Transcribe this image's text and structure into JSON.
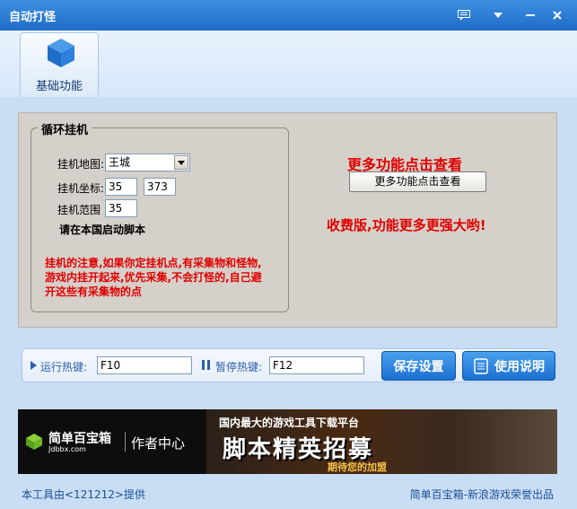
{
  "window": {
    "title": "自动打怪",
    "controls": [
      "message-icon",
      "dropdown-icon",
      "minimize-icon",
      "close-icon"
    ]
  },
  "tabs": [
    {
      "label": "基础功能",
      "icon": "cube-icon"
    }
  ],
  "loop_group": {
    "title": "循环挂机",
    "map_label": "挂机地图:",
    "map_value": "王城",
    "coord_label": "挂机坐标:",
    "coord_x": "35",
    "coord_y": "373",
    "range_label": "挂机范围",
    "range_value": "35",
    "start_note": "请在本国启动脚本",
    "notice": [
      "挂机的注意,如果你定挂机点,有采集物和怪物,",
      "游戏内挂开起来,优先采集,不会打怪的,自己避",
      "开这些有采集物的点"
    ]
  },
  "more": {
    "heading": "更多功能点击查看",
    "button_label": "更多功能点击查看",
    "paid_text": "收费版,功能更多更强大哟!"
  },
  "hotkeys": {
    "run_label": "运行热键:",
    "run_value": "F10",
    "pause_label": "暂停热键:",
    "pause_value": "F12",
    "save_label": "保存设置",
    "help_label": "使用说明"
  },
  "banner": {
    "brand": "简单百宝箱",
    "brand_url": "Jdbbx.com",
    "center": "作者中心",
    "promo_top": "国内最大的游戏工具下载平台",
    "promo_big": "脚本精英招募",
    "promo_sub": "期待您的加盟"
  },
  "footer": {
    "left": "本工具由<121212>提供",
    "right": "简单百宝箱-新浪游戏荣誉出品"
  },
  "colors": {
    "title_blue": "#1f6cc9",
    "accent_red": "#e00000",
    "panel": "#d5d0c9"
  }
}
